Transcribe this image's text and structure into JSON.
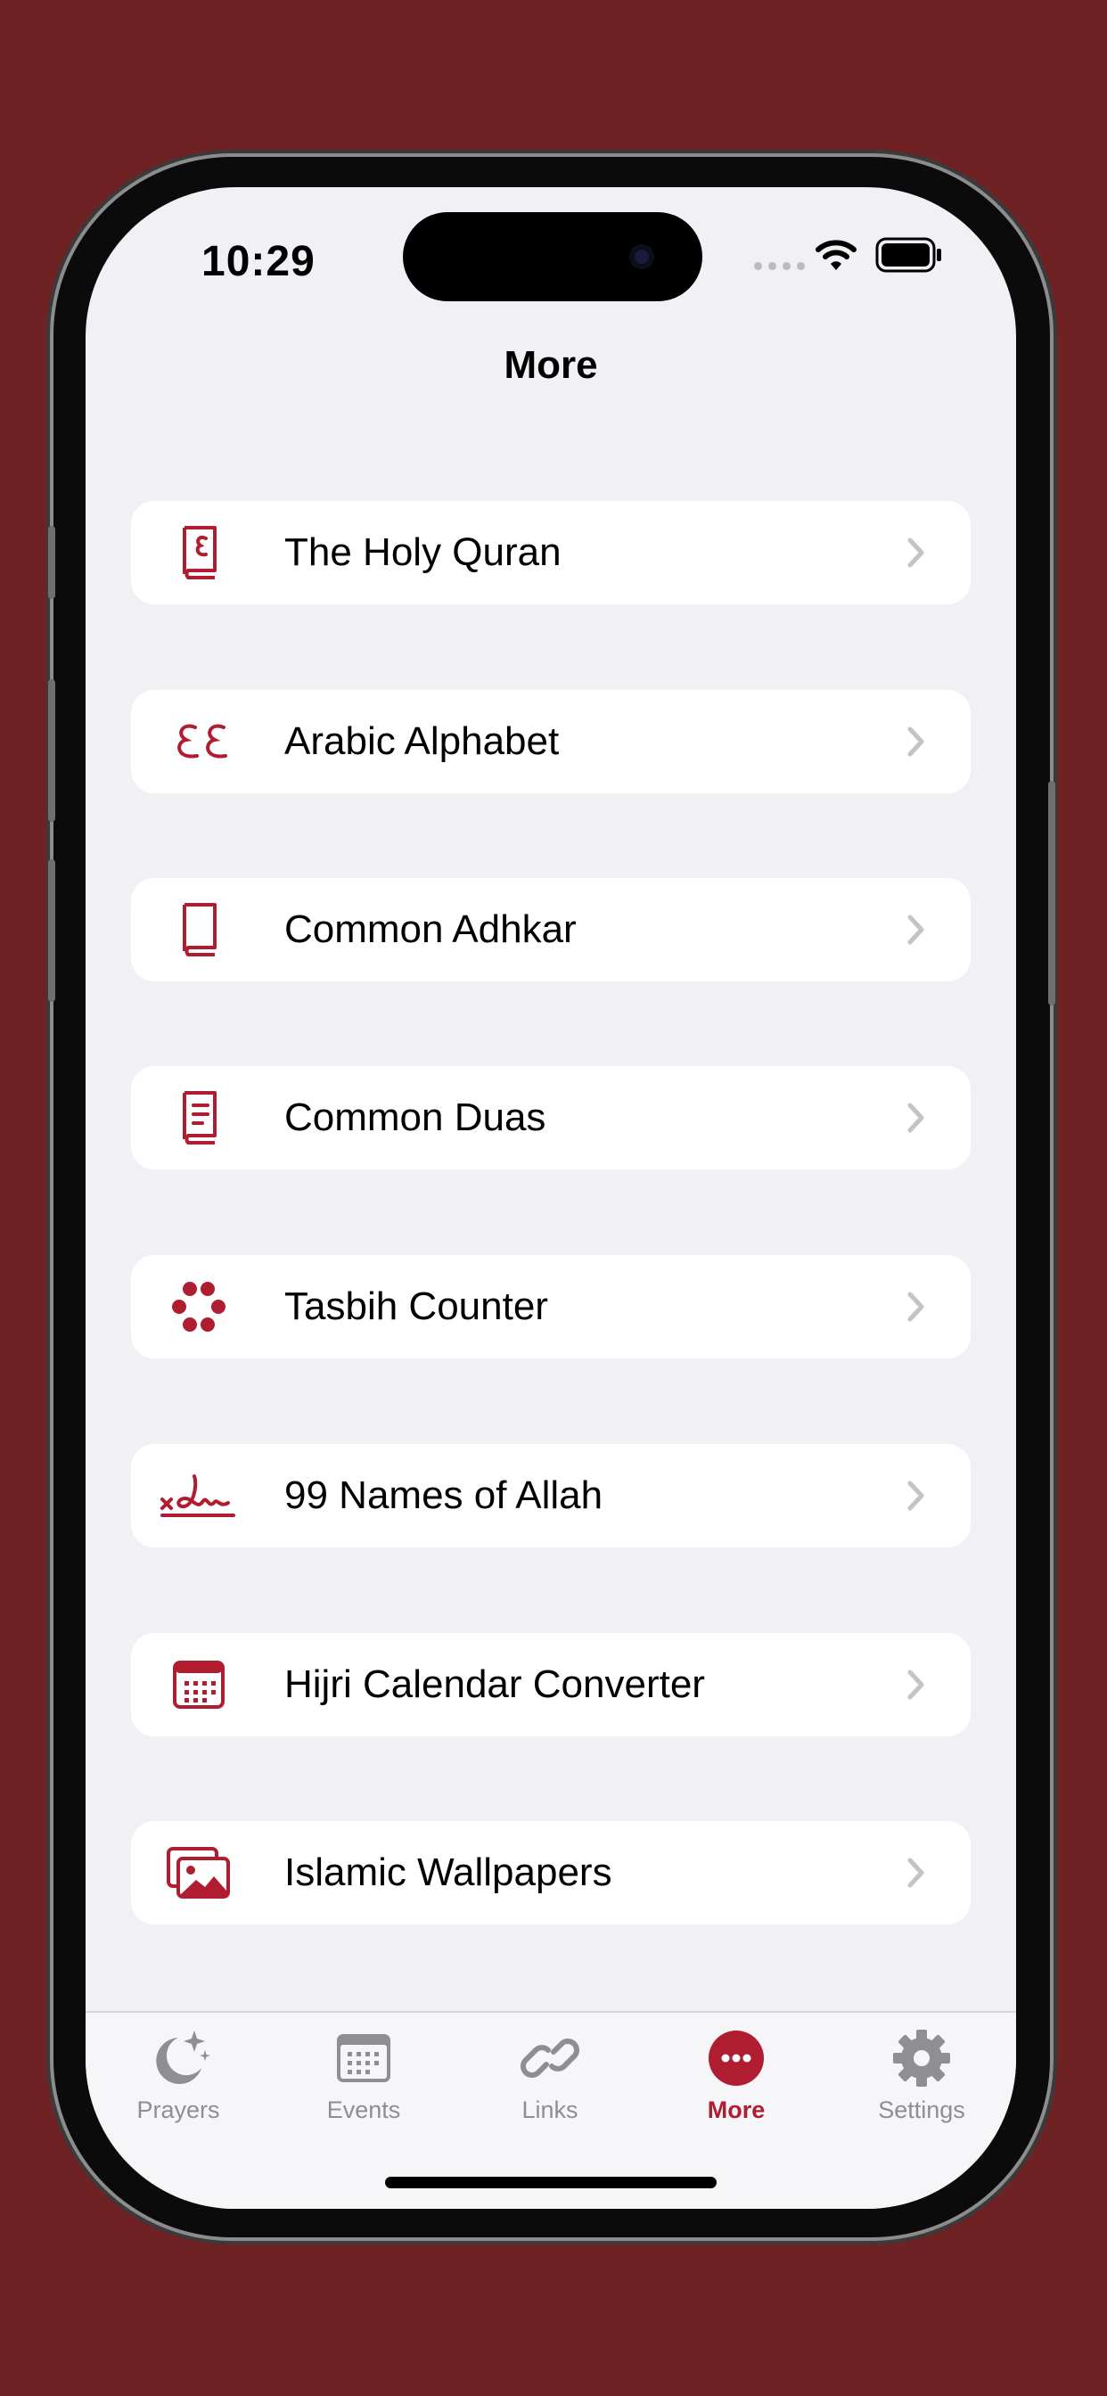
{
  "status_bar": {
    "time": "10:29"
  },
  "nav": {
    "title": "More"
  },
  "colors": {
    "accent": "#b01c30",
    "background": "#6e2224",
    "inactive_tab": "#8e8e93"
  },
  "menu": [
    {
      "label": "The Holy Quran",
      "icon": "quran-book-icon"
    },
    {
      "label": "Arabic Alphabet",
      "icon": "arabic-letters-icon"
    },
    {
      "label": "Common Adhkar",
      "icon": "book-icon"
    },
    {
      "label": "Common Duas",
      "icon": "book-text-icon"
    },
    {
      "label": "Tasbih Counter",
      "icon": "beads-icon"
    },
    {
      "label": "99 Names of Allah",
      "icon": "signature-icon"
    },
    {
      "label": "Hijri Calendar Converter",
      "icon": "calendar-icon"
    },
    {
      "label": "Islamic Wallpapers",
      "icon": "photos-icon"
    }
  ],
  "tabs": [
    {
      "label": "Prayers",
      "icon": "moon-stars-icon",
      "active": false
    },
    {
      "label": "Events",
      "icon": "calendar-icon",
      "active": false
    },
    {
      "label": "Links",
      "icon": "link-icon",
      "active": false
    },
    {
      "label": "More",
      "icon": "ellipsis-circle-icon",
      "active": true
    },
    {
      "label": "Settings",
      "icon": "gear-icon",
      "active": false
    }
  ]
}
